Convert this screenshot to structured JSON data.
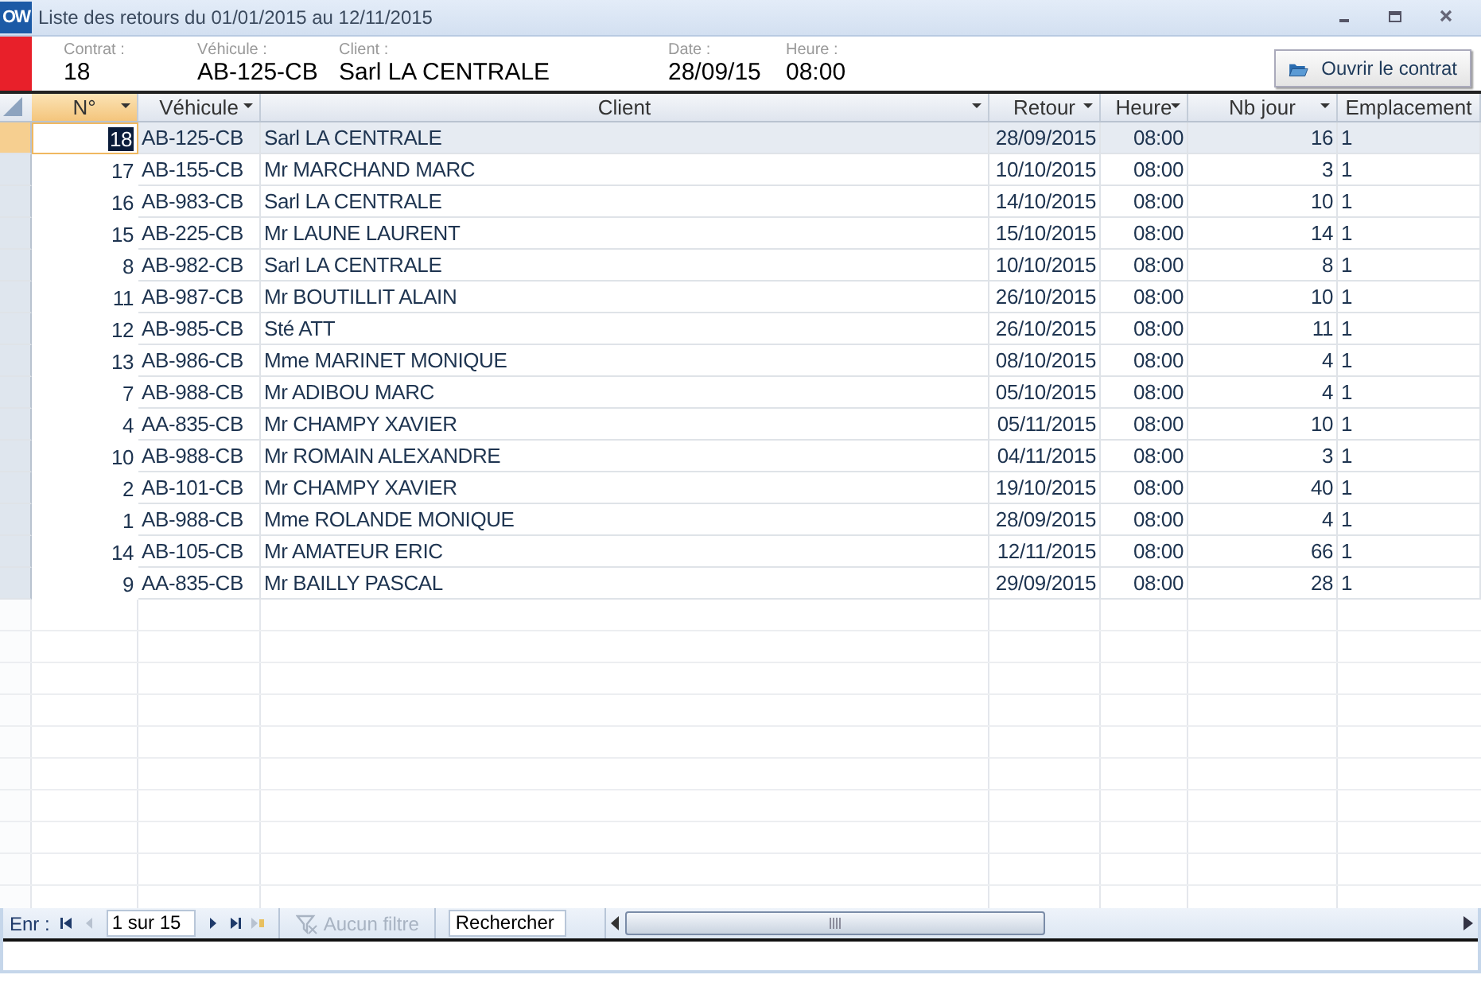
{
  "window": {
    "title": "Liste des retours du 01/01/2015 au 12/11/2015",
    "logo": "OW"
  },
  "header": {
    "fields": [
      {
        "label": "Contrat :",
        "value": "18"
      },
      {
        "label": "Véhicule :",
        "value": "AB-125-CB"
      },
      {
        "label": "Client :",
        "value": "Sarl LA CENTRALE"
      },
      {
        "label": "Date :",
        "value": "28/09/15"
      },
      {
        "label": "Heure :",
        "value": "08:00"
      }
    ],
    "button": "Ouvrir le contrat"
  },
  "table": {
    "columns": [
      {
        "label": "N°",
        "filter": true,
        "selected": true
      },
      {
        "label": "Véhicule",
        "filter": true,
        "selected": false
      },
      {
        "label": "Client",
        "filter": true,
        "selected": false
      },
      {
        "label": "Retour",
        "filter": true,
        "selected": false
      },
      {
        "label": "Heure",
        "filter": true,
        "selected": false
      },
      {
        "label": "Nb jour",
        "filter": true,
        "selected": false
      },
      {
        "label": "Emplacement",
        "filter": false,
        "selected": false
      }
    ],
    "rows": [
      {
        "selected": true,
        "cells": [
          "18",
          "AB-125-CB",
          "Sarl LA CENTRALE",
          "28/09/2015",
          "08:00",
          "16",
          "1"
        ]
      },
      {
        "selected": false,
        "cells": [
          "17",
          "AB-155-CB",
          "Mr MARCHAND MARC",
          "10/10/2015",
          "08:00",
          "3",
          "1"
        ]
      },
      {
        "selected": false,
        "cells": [
          "16",
          "AB-983-CB",
          "Sarl LA CENTRALE",
          "14/10/2015",
          "08:00",
          "10",
          "1"
        ]
      },
      {
        "selected": false,
        "cells": [
          "15",
          "AB-225-CB",
          "Mr LAUNE LAURENT",
          "15/10/2015",
          "08:00",
          "14",
          "1"
        ]
      },
      {
        "selected": false,
        "cells": [
          "8",
          "AB-982-CB",
          "Sarl LA CENTRALE",
          "10/10/2015",
          "08:00",
          "8",
          "1"
        ]
      },
      {
        "selected": false,
        "cells": [
          "11",
          "AB-987-CB",
          "Mr BOUTILLIT ALAIN",
          "26/10/2015",
          "08:00",
          "10",
          "1"
        ]
      },
      {
        "selected": false,
        "cells": [
          "12",
          "AB-985-CB",
          "Sté ATT",
          "26/10/2015",
          "08:00",
          "11",
          "1"
        ]
      },
      {
        "selected": false,
        "cells": [
          "13",
          "AB-986-CB",
          "Mme MARINET MONIQUE",
          "08/10/2015",
          "08:00",
          "4",
          "1"
        ]
      },
      {
        "selected": false,
        "cells": [
          "7",
          "AB-988-CB",
          "Mr ADIBOU MARC",
          "05/10/2015",
          "08:00",
          "4",
          "1"
        ]
      },
      {
        "selected": false,
        "cells": [
          "4",
          "AA-835-CB",
          "Mr CHAMPY XAVIER",
          "05/11/2015",
          "08:00",
          "10",
          "1"
        ]
      },
      {
        "selected": false,
        "cells": [
          "10",
          "AB-988-CB",
          "Mr ROMAIN ALEXANDRE",
          "04/11/2015",
          "08:00",
          "3",
          "1"
        ]
      },
      {
        "selected": false,
        "cells": [
          "2",
          "AB-101-CB",
          "Mr CHAMPY XAVIER",
          "19/10/2015",
          "08:00",
          "40",
          "1"
        ]
      },
      {
        "selected": false,
        "cells": [
          "1",
          "AB-988-CB",
          "Mme ROLANDE MONIQUE",
          "28/09/2015",
          "08:00",
          "4",
          "1"
        ]
      },
      {
        "selected": false,
        "cells": [
          "14",
          "AB-105-CB",
          "Mr AMATEUR ERIC",
          "12/11/2015",
          "08:00",
          "66",
          "1"
        ]
      },
      {
        "selected": false,
        "cells": [
          "9",
          "AA-835-CB",
          "Mr BAILLY PASCAL",
          "29/09/2015",
          "08:00",
          "28",
          "1"
        ]
      }
    ]
  },
  "nav": {
    "label": "Enr :",
    "position": "1 sur 15",
    "filter": "Aucun filtre",
    "filter_disabled": true,
    "search": "Rechercher"
  }
}
